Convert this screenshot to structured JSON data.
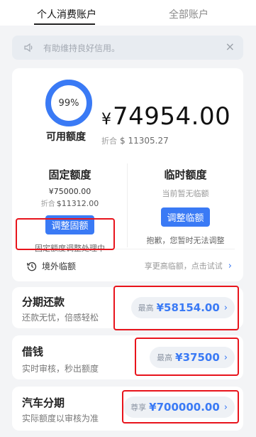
{
  "tabs": {
    "personal": "个人消费账户",
    "all": "全部账户"
  },
  "notice": {
    "text": "有助维持良好信用。",
    "close": "×"
  },
  "summary": {
    "ring_percent_label": "99%",
    "ring_fraction": 0.99,
    "available_label": "可用额度",
    "currency": "¥",
    "amount": "74954.00",
    "equiv_prefix": "折合",
    "equiv_value": "$ 11305.27"
  },
  "fixed": {
    "title": "固定额度",
    "amount": "¥75000.00",
    "equiv_prefix": "折合",
    "equiv_value": "$11312.00",
    "button": "调整固额",
    "note": "固定额度调整处理中"
  },
  "temp": {
    "title": "临时额度",
    "status": "当前暂无临额",
    "button": "调整临额",
    "note": "抱歉，您暂时无法调整"
  },
  "abroad": {
    "label": "境外临额",
    "hint": "享更高临额，点击试试"
  },
  "products": [
    {
      "name": "分期还款",
      "desc": "还款无忧，倍感轻松",
      "prefix": "最高",
      "amount": "¥58154.00"
    },
    {
      "name": "借钱",
      "desc": "实时审核，秒出额度",
      "prefix": "最高",
      "amount": "¥37500"
    },
    {
      "name": "汽车分期",
      "desc": "实际额度以审核为准",
      "prefix": "尊享",
      "amount": "¥700000.00"
    }
  ],
  "colors": {
    "accent": "#3a7af5",
    "highlight": "#e8141c",
    "ring_track": "#e6ecf5"
  }
}
